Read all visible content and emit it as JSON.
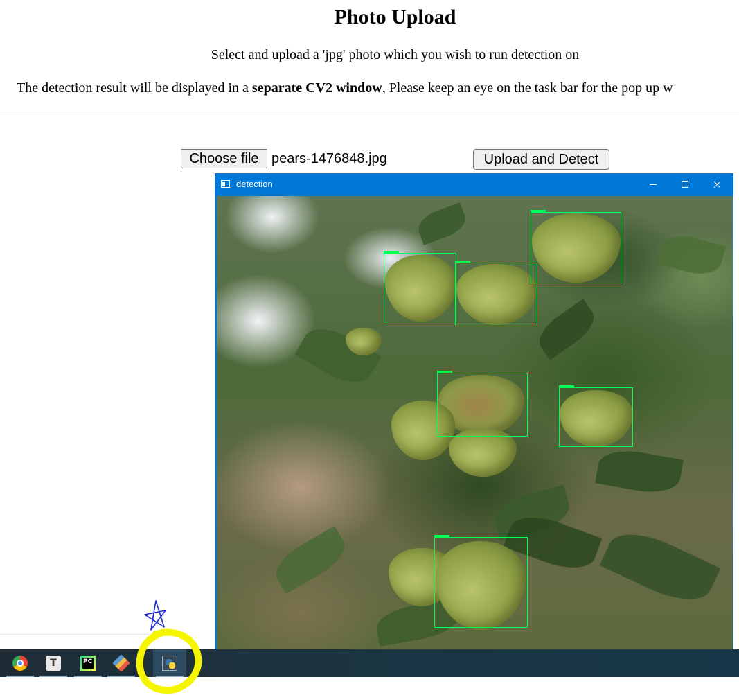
{
  "page": {
    "title": "Photo Upload",
    "instruction": "Select and upload a 'jpg' photo which you wish to run detection on",
    "note_prefix": "The detection result will be displayed in a ",
    "note_bold": "separate CV2 window",
    "note_suffix": ", Please keep an eye on the task bar for the pop up w"
  },
  "upload_form": {
    "choose_file_label": "Choose file",
    "selected_file": "pears-1476848.jpg",
    "upload_button_label": "Upload and Detect"
  },
  "detection_window": {
    "title": "detection",
    "icon": "window-app-icon",
    "controls": [
      "minimize-icon",
      "maximize-icon",
      "close-icon"
    ],
    "box_color": "#00ff55",
    "detections_count": 6
  },
  "taskbar": {
    "items": [
      {
        "icon": "chrome-icon"
      },
      {
        "icon": "text-editor-icon",
        "glyph": "T"
      },
      {
        "icon": "pycharm-icon",
        "glyph": "PC"
      },
      {
        "icon": "git-icon"
      },
      {
        "icon": "python-icon",
        "active": true
      }
    ],
    "highlight_color": "#f5f500",
    "annotation_color": "#1d2bd6"
  }
}
